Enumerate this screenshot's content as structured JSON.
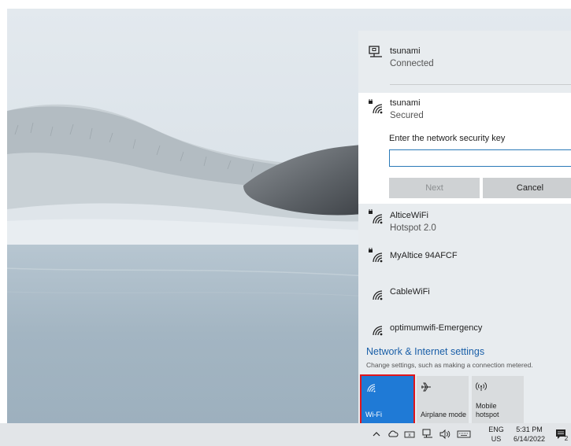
{
  "current_network": {
    "name": "tsunami",
    "status": "Connected",
    "icon": "ethernet-icon"
  },
  "selected_network": {
    "name": "tsunami",
    "status": "Secured",
    "key_label": "Enter the network security key",
    "key_value": "",
    "next_label": "Next",
    "cancel_label": "Cancel"
  },
  "networks": [
    {
      "name": "AlticeWiFi",
      "sub": "Hotspot 2.0",
      "secured": true
    },
    {
      "name": "MyAltice 94AFCF",
      "sub": "",
      "secured": true
    },
    {
      "name": "CableWiFi",
      "sub": "",
      "secured": false
    },
    {
      "name": "optimumwifi-Emergency",
      "sub": "",
      "secured": false
    }
  ],
  "settings": {
    "link": "Network & Internet settings",
    "description": "Change settings, such as making a connection metered."
  },
  "quick_actions": [
    {
      "label": "Wi-Fi",
      "icon": "wifi-icon",
      "active": true
    },
    {
      "label": "Airplane mode",
      "icon": "airplane-icon",
      "active": false
    },
    {
      "label_line1": "Mobile",
      "label_line2": "hotspot",
      "icon": "hotspot-icon",
      "active": false
    }
  ],
  "taskbar": {
    "lang": "ENG",
    "region": "US",
    "time": "5:31 PM",
    "date": "6/14/2022",
    "notification_count": "2"
  },
  "colors": {
    "accent": "#1f7ad6",
    "highlight_box": "#e0171d",
    "flyout_bg": "#e8ecef"
  }
}
